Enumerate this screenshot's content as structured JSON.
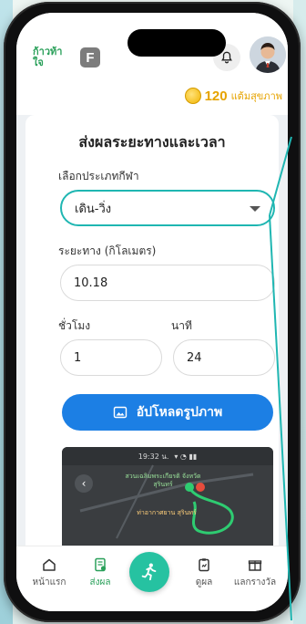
{
  "header": {
    "logo_text": "ก้าวท้าใจ",
    "f_logo": "F",
    "points_value": "120",
    "points_label": "แต้มสุขภาพ"
  },
  "form": {
    "title": "ส่งผลระยะทางและเวลา",
    "sport_label": "เลือกประเภทกีฬา",
    "sport_value": "เดิน-วิ่ง",
    "distance_label": "ระยะทาง (กิโลเมตร)",
    "distance_value": "10.18",
    "hours_label": "ชั่วโมง",
    "hours_value": "1",
    "minutes_label": "นาที",
    "minutes_value": "24",
    "upload_label": "อัปโหลดรูปภาพ"
  },
  "map_preview": {
    "status_time": "19:32 น.",
    "place1": "สวนเฉลิมพระเกียรติ จังหวัดสุรินทร์",
    "place2": "ท่าอากาศยาน สุรินทร์"
  },
  "nav": {
    "home": "หน้าแรก",
    "submit": "ส่งผล",
    "view": "ดูผล",
    "exchange": "แลกรางวัล"
  },
  "colors": {
    "accent_teal": "#1fb6b2",
    "upload_blue": "#1c7fe4",
    "points_gold": "#e6a300",
    "nav_active": "#2aa05a"
  }
}
